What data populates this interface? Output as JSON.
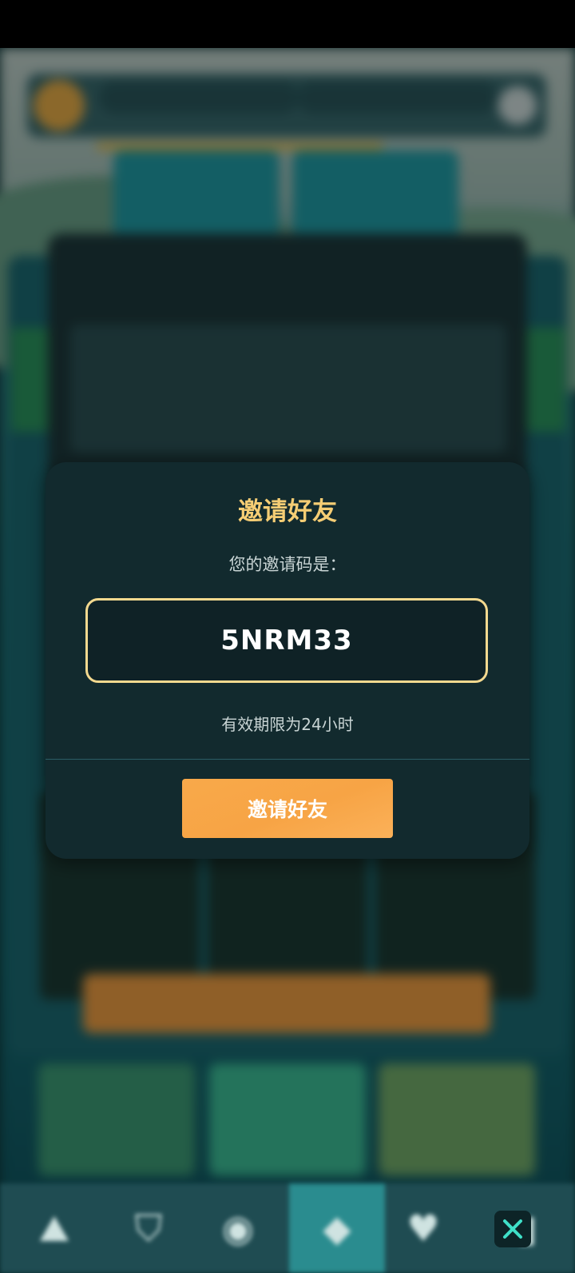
{
  "dialog": {
    "title": "邀请好友",
    "subtitle": "您的邀请码是：",
    "invite_code": "5NRM33",
    "expiry_note": "有效期限为24小时",
    "button_label": "邀请好友"
  },
  "bottom_nav": {
    "items": [
      {
        "icon": "mountain-icon",
        "glyph": "⛰"
      },
      {
        "icon": "shield-icon",
        "glyph": "⛉"
      },
      {
        "icon": "compass-icon",
        "glyph": "◉"
      },
      {
        "icon": "diamond-icon",
        "glyph": "◆"
      },
      {
        "icon": "heart-icon",
        "glyph": "♥"
      },
      {
        "icon": "book-icon",
        "glyph": "▮"
      }
    ]
  },
  "colors": {
    "accent_gold": "#f5cd74",
    "button_orange": "#f7a445",
    "dialog_bg": "#122a2e",
    "close_icon": "#3fe0c8"
  }
}
